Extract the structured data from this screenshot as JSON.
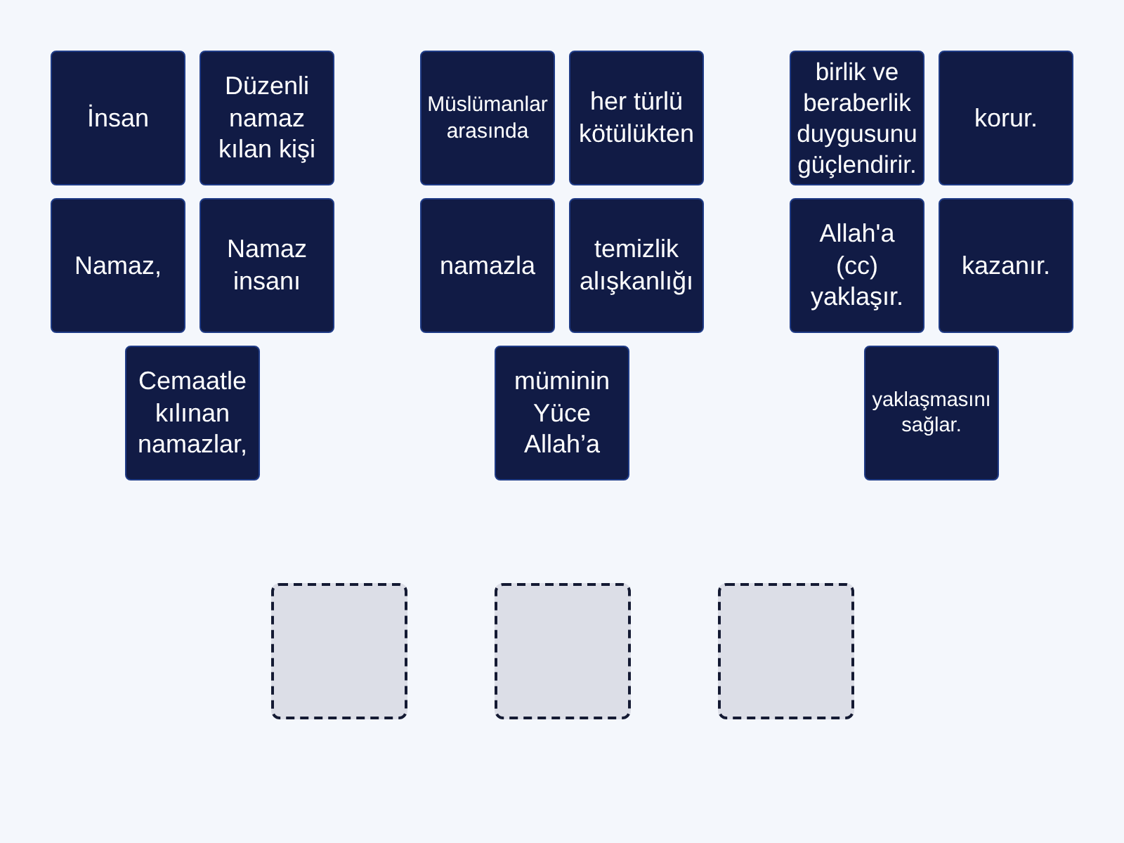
{
  "groups": [
    {
      "tiles": [
        "İnsan",
        "Düzenli namaz kılan kişi",
        "Namaz,",
        "Namaz insanı",
        "Cemaatle kılınan namazlar,"
      ]
    },
    {
      "tiles": [
        "Müslümanlar arasında",
        "her türlü kötülükten",
        "namazla",
        "temizlik alışkanlığı",
        "müminin Yüce Allah’a"
      ]
    },
    {
      "tiles": [
        "birlik ve beraberlik duygusunu güçlendirir.",
        "korur.",
        "Allah'a (cc) yaklaşır.",
        "kazanır.",
        "yaklaşmasını sağlar."
      ]
    }
  ],
  "slots": [
    {
      "filled": false
    },
    {
      "filled": false
    },
    {
      "filled": false
    }
  ]
}
